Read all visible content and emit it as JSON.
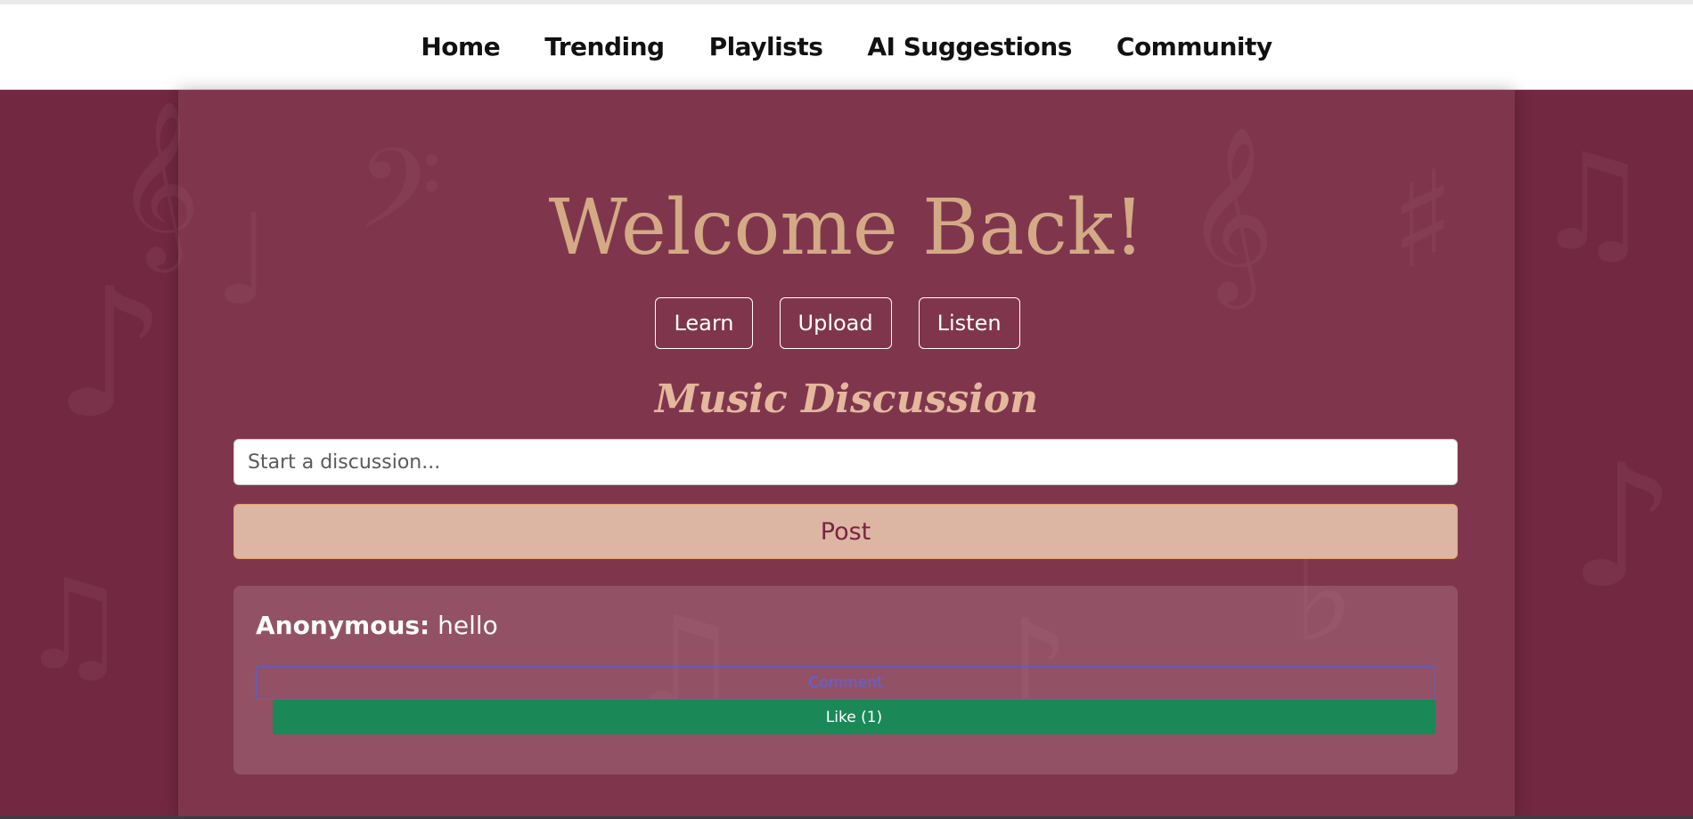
{
  "nav": {
    "links": [
      "Home",
      "Trending",
      "Playlists",
      "AI Suggestions",
      "Community"
    ]
  },
  "hero": {
    "title": "Welcome Back!"
  },
  "actions": {
    "learn": "Learn",
    "upload": "Upload",
    "listen": "Listen"
  },
  "discussion": {
    "title": "Music Discussion",
    "placeholder": "Start a discussion...",
    "post_label": "Post"
  },
  "posts": [
    {
      "author": "Anonymous:",
      "message": "hello",
      "comment_label": "Comment",
      "like_label": "Like (1)"
    }
  ],
  "colors": {
    "background": "#722840",
    "title": "#d3aa85",
    "post_button": "#dcb6a3",
    "like_button": "#1b8858",
    "comment_border": "#5560d8"
  }
}
